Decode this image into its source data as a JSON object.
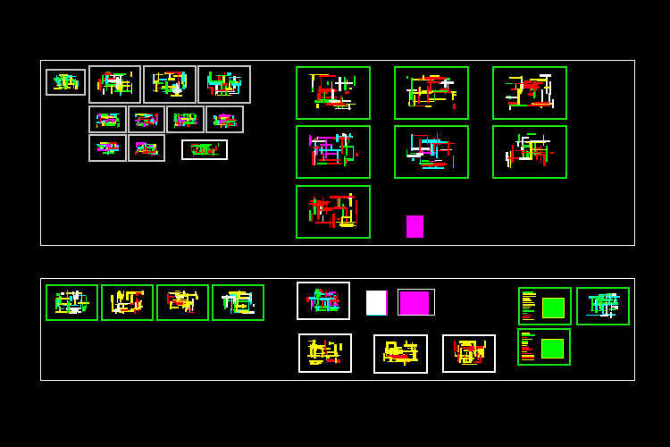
{
  "colors": {
    "background": "#000000",
    "frame": "#ffffff",
    "sheet_border_white": "#c8c8c8",
    "sheet_border_green": "#17e617",
    "plan_yellow": "#ffff00",
    "plan_red": "#ff0000",
    "plan_green": "#00ff00",
    "plan_cyan": "#00ffff",
    "plan_magenta": "#ff00ff",
    "plan_white": "#ffffff"
  }
}
